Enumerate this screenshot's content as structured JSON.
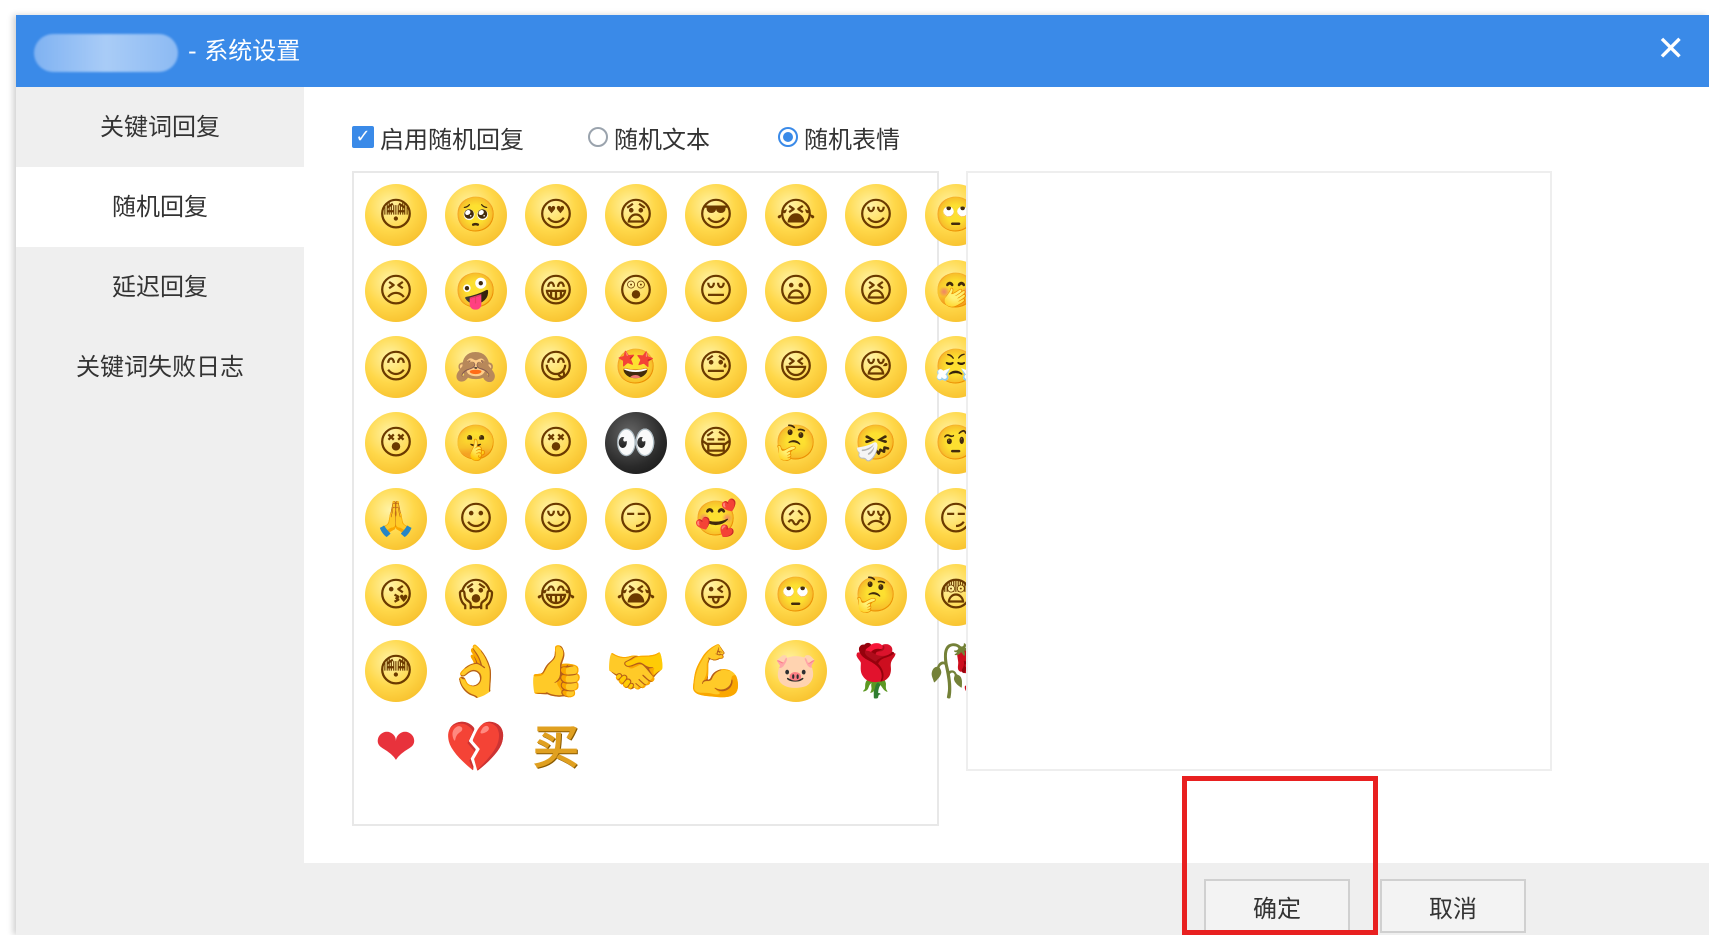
{
  "titlebar": {
    "title": "- 系统设置",
    "close_glyph": "✕"
  },
  "sidebar": {
    "items": [
      {
        "label": "关键词回复",
        "active": false
      },
      {
        "label": "随机回复",
        "active": true
      },
      {
        "label": "延迟回复",
        "active": false
      },
      {
        "label": "关键词失败日志",
        "active": false
      }
    ]
  },
  "options": {
    "enable_random_label": "启用随机回复",
    "enable_random_checked": true,
    "random_text_label": "随机文本",
    "random_emoji_label": "随机表情",
    "selected_mode": "随机表情",
    "check_glyph": "✓"
  },
  "emoji_panel": {
    "faces": [
      "😳",
      "🥺",
      "😍",
      "😧",
      "😎",
      "😭",
      "😌",
      "🙄",
      "😣",
      "🤪",
      "😁",
      "😲",
      "😔",
      "😦",
      "😫",
      "🤭",
      "😊",
      "🙈",
      "😋",
      "🤩",
      "😓",
      "😆",
      "😪",
      "😤",
      "😵",
      "🤫",
      "😵",
      "👀",
      "😷",
      "🤔",
      "🤧",
      "🤨",
      "🙏",
      "☺",
      "😌",
      "😏",
      "🥰",
      "😖",
      "😢",
      "😏",
      "😘",
      "😱",
      "😂",
      "😭",
      "😜",
      "🙄",
      "🤔",
      "😨"
    ],
    "extras_row": [
      "😳",
      "👌",
      "👍",
      "🤝",
      "💪",
      "🐷",
      "🌹",
      "🥀"
    ],
    "last_row": [
      "❤",
      "💔",
      "买"
    ]
  },
  "footer": {
    "confirm_label": "确定",
    "cancel_label": "取消"
  },
  "colors": {
    "titlebar_blue": "#3a8ae8",
    "sidebar_bg": "#efefef",
    "highlight_red": "#e82020"
  }
}
